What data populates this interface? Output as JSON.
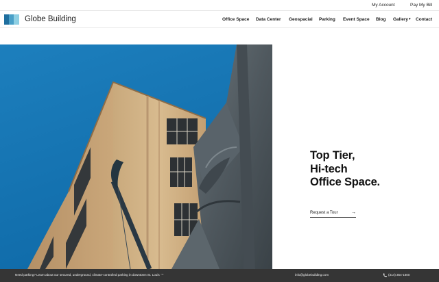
{
  "utility": {
    "my_account": "My Account",
    "pay_my_bill": "Pay My Bill"
  },
  "brand": {
    "name": "Globe Building",
    "logo_icon": "globe-building-logo-icon",
    "logo_colors": [
      "#1f6f9f",
      "#4aa0c8",
      "#8ecfe3"
    ]
  },
  "nav": {
    "items": [
      {
        "label": "Office Space"
      },
      {
        "label": "Data Center"
      },
      {
        "label": "Geospacial"
      },
      {
        "label": "Parking"
      },
      {
        "label": "Event Space"
      },
      {
        "label": "Blog"
      },
      {
        "label": "Gallery",
        "has_dropdown": true
      },
      {
        "label": "Contact"
      }
    ]
  },
  "hero": {
    "headline_lines": [
      "Top Tier,",
      "Hi-tech",
      "Office Space."
    ],
    "cta_label": "Request a Tour",
    "cta_icon": "arrow-right-icon",
    "image_subject": "building-photo"
  },
  "footer": {
    "parking_notice": "Need parking? Learn about our secured, underground, climate-controlled parking in downtown St. Louis",
    "parking_arrow_icon": "arrow-right-icon",
    "email": "info@globebuilding.com",
    "phone_icon": "phone-icon",
    "phone": "(314) 354-1600",
    "background_color": "#353535"
  }
}
